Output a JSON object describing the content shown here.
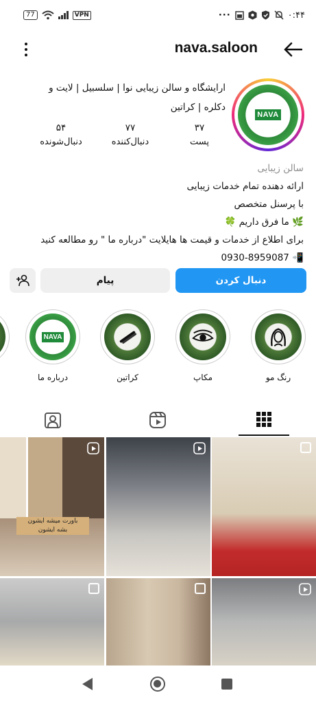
{
  "status_bar": {
    "battery": "77",
    "vpn": "VPN",
    "dots": "···",
    "time": "۰:۴۴"
  },
  "header": {
    "username": "nava.saloon"
  },
  "profile": {
    "logo_text": "NAVA",
    "full_name": "ارایشگاه و سالن زیبایی نوا | سلسبیل | لایت و دکلره | کراتین",
    "stats": [
      {
        "num": "۳۷",
        "label": "پست"
      },
      {
        "num": "۷۷",
        "label": "دنبال‌کننده"
      },
      {
        "num": "۵۴",
        "label": "دنبال‌شونده"
      }
    ],
    "category": "سالن زیبایی",
    "bio_lines": [
      "ارائه دهنده تمام خدمات زیبایی",
      "با پرسنل متخصص",
      "🌿 ما فرق داریم 🍀",
      "برای اطلاع از خدمات و قیمت ها هایلایت \"درباره ما \" رو مطالعه کنید",
      "📲 0930-8959087"
    ]
  },
  "buttons": {
    "follow": "دنبال کردن",
    "message": "پیام"
  },
  "highlights": [
    {
      "label": "رنگ مو",
      "icon": "hair-color-icon"
    },
    {
      "label": "مکاپ",
      "icon": "eye-makeup-icon"
    },
    {
      "label": "کراتین",
      "icon": "flat-iron-icon"
    },
    {
      "label": "درباره ما",
      "icon": "nava-logo",
      "logo_text": "NAVA"
    }
  ],
  "grid_overlay_text": {
    "line1": "باورت میشه ایشون",
    "line2": "بشه ایشون"
  },
  "colors": {
    "follow_blue": "#2196f3",
    "button_grey": "#efefef",
    "muted": "#8e8e8e"
  }
}
